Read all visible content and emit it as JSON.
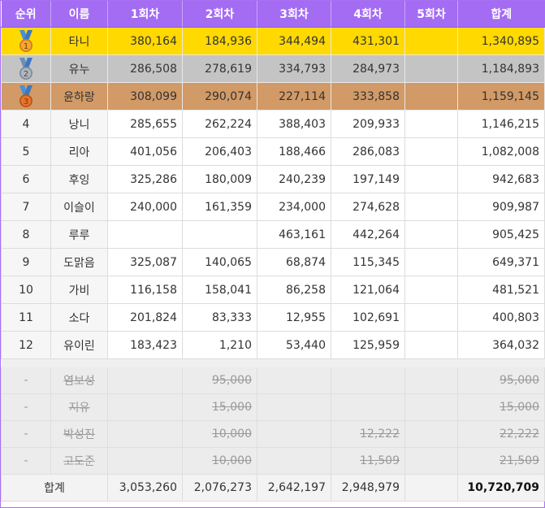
{
  "headers": [
    "순위",
    "이름",
    "1회차",
    "2회차",
    "3회차",
    "4회차",
    "5회차",
    "합계"
  ],
  "colors": {
    "header": "#a36cf3",
    "gold": "#ffd900",
    "silver": "#c4c4c4",
    "bronze": "#d29a66",
    "frame": "#a871f4"
  },
  "medals": [
    {
      "rank": "1",
      "icon": "gold-medal-icon"
    },
    {
      "rank": "2",
      "icon": "silver-medal-icon"
    },
    {
      "rank": "3",
      "icon": "bronze-medal-icon"
    }
  ],
  "rows": [
    {
      "rank": "",
      "name": "타니",
      "r1": "380,164",
      "r2": "184,936",
      "r3": "344,494",
      "r4": "431,301",
      "r5": "",
      "total": "1,340,895"
    },
    {
      "rank": "",
      "name": "유누",
      "r1": "286,508",
      "r2": "278,619",
      "r3": "334,793",
      "r4": "284,973",
      "r5": "",
      "total": "1,184,893"
    },
    {
      "rank": "",
      "name": "윤하랑",
      "r1": "308,099",
      "r2": "290,074",
      "r3": "227,114",
      "r4": "333,858",
      "r5": "",
      "total": "1,159,145"
    },
    {
      "rank": "4",
      "name": "낭니",
      "r1": "285,655",
      "r2": "262,224",
      "r3": "388,403",
      "r4": "209,933",
      "r5": "",
      "total": "1,146,215"
    },
    {
      "rank": "5",
      "name": "리아",
      "r1": "401,056",
      "r2": "206,403",
      "r3": "188,466",
      "r4": "286,083",
      "r5": "",
      "total": "1,082,008"
    },
    {
      "rank": "6",
      "name": "후잉",
      "r1": "325,286",
      "r2": "180,009",
      "r3": "240,239",
      "r4": "197,149",
      "r5": "",
      "total": "942,683"
    },
    {
      "rank": "7",
      "name": "이슬이",
      "r1": "240,000",
      "r2": "161,359",
      "r3": "234,000",
      "r4": "274,628",
      "r5": "",
      "total": "909,987"
    },
    {
      "rank": "8",
      "name": "루루",
      "r1": "",
      "r2": "",
      "r3": "463,161",
      "r4": "442,264",
      "r5": "",
      "total": "905,425"
    },
    {
      "rank": "9",
      "name": "도맑음",
      "r1": "325,087",
      "r2": "140,065",
      "r3": "68,874",
      "r4": "115,345",
      "r5": "",
      "total": "649,371"
    },
    {
      "rank": "10",
      "name": "가비",
      "r1": "116,158",
      "r2": "158,041",
      "r3": "86,258",
      "r4": "121,064",
      "r5": "",
      "total": "481,521"
    },
    {
      "rank": "11",
      "name": "소다",
      "r1": "201,824",
      "r2": "83,333",
      "r3": "12,955",
      "r4": "102,691",
      "r5": "",
      "total": "400,803"
    },
    {
      "rank": "12",
      "name": "유이린",
      "r1": "183,423",
      "r2": "1,210",
      "r3": "53,440",
      "r4": "125,959",
      "r5": "",
      "total": "364,032"
    }
  ],
  "excluded": [
    {
      "rank": "-",
      "name": "염보성",
      "r1": "",
      "r2": "95,000",
      "r3": "",
      "r4": "",
      "r5": "",
      "total": "95,000"
    },
    {
      "rank": "-",
      "name": "지유",
      "r1": "",
      "r2": "15,000",
      "r3": "",
      "r4": "",
      "r5": "",
      "total": "15,000"
    },
    {
      "rank": "-",
      "name": "박성진",
      "r1": "",
      "r2": "10,000",
      "r3": "",
      "r4": "12,222",
      "r5": "",
      "total": "22,222"
    },
    {
      "rank": "-",
      "name": "고도준",
      "r1": "",
      "r2": "10,000",
      "r3": "",
      "r4": "11,509",
      "r5": "",
      "total": "21,509"
    }
  ],
  "totals": {
    "label": "합계",
    "r1": "3,053,260",
    "r2": "2,076,273",
    "r3": "2,642,197",
    "r4": "2,948,979",
    "r5": "",
    "total": "10,720,709"
  }
}
